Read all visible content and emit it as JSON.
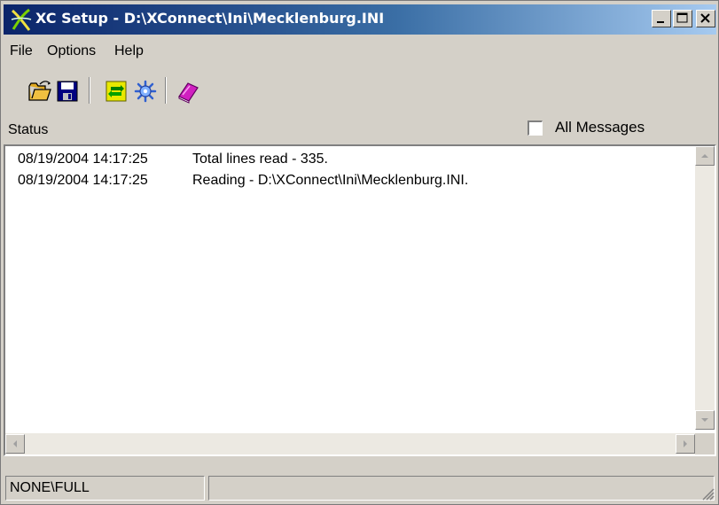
{
  "window": {
    "title": "XC Setup - D:\\XConnect\\Ini\\Mecklenburg.INI"
  },
  "menu": [
    "File",
    "Options",
    "Help"
  ],
  "toolbar": {
    "icons": [
      "open-folder-icon",
      "save-disk-icon",
      "refresh-icon",
      "gear-icon",
      "help-book-icon"
    ]
  },
  "status_section": {
    "label": "Status"
  },
  "all_messages": {
    "label": "All Messages",
    "checked": false
  },
  "log": [
    {
      "timestamp": "08/19/2004 14:17:25",
      "message": "Total lines read - 335."
    },
    {
      "timestamp": "08/19/2004 14:17:25",
      "message": "Reading - D:\\XConnect\\Ini\\Mecklenburg.INI."
    }
  ],
  "statusbar": {
    "mode": "NONE\\FULL",
    "panel2": ""
  },
  "colors": {
    "titlebar_start": "#0a246a",
    "titlebar_end": "#a6caf0",
    "face": "#d4d0c8"
  }
}
